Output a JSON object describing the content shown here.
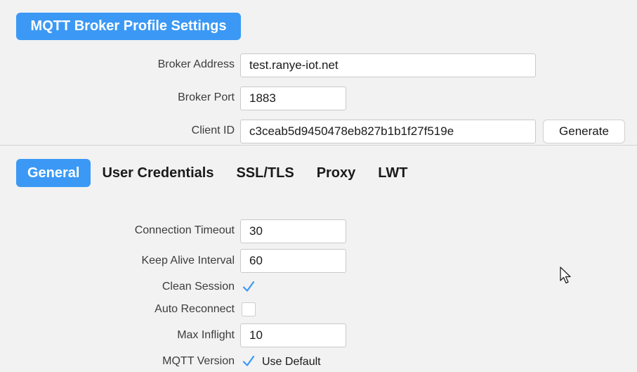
{
  "header": {
    "title": "MQTT Broker Profile Settings"
  },
  "broker": {
    "address_label": "Broker Address",
    "address_value": "test.ranye-iot.net",
    "port_label": "Broker Port",
    "port_value": "1883",
    "client_id_label": "Client ID",
    "client_id_value": "c3ceab5d9450478eb827b1b1f27f519e",
    "generate_label": "Generate"
  },
  "tabs": [
    {
      "label": "General",
      "active": true
    },
    {
      "label": "User Credentials",
      "active": false
    },
    {
      "label": "SSL/TLS",
      "active": false
    },
    {
      "label": "Proxy",
      "active": false
    },
    {
      "label": "LWT",
      "active": false
    }
  ],
  "general": {
    "connection_timeout_label": "Connection Timeout",
    "connection_timeout_value": "30",
    "keep_alive_label": "Keep Alive Interval",
    "keep_alive_value": "60",
    "clean_session_label": "Clean Session",
    "clean_session_checked": true,
    "auto_reconnect_label": "Auto Reconnect",
    "auto_reconnect_checked": false,
    "max_inflight_label": "Max Inflight",
    "max_inflight_value": "10",
    "mqtt_version_label": "MQTT Version",
    "use_default_checked": true,
    "use_default_label": "Use Default"
  },
  "colors": {
    "accent": "#3b99f5",
    "background": "#f2f2f2"
  },
  "icons": {
    "checkmark": "checkmark-icon",
    "cursor": "mouse-pointer-icon"
  }
}
